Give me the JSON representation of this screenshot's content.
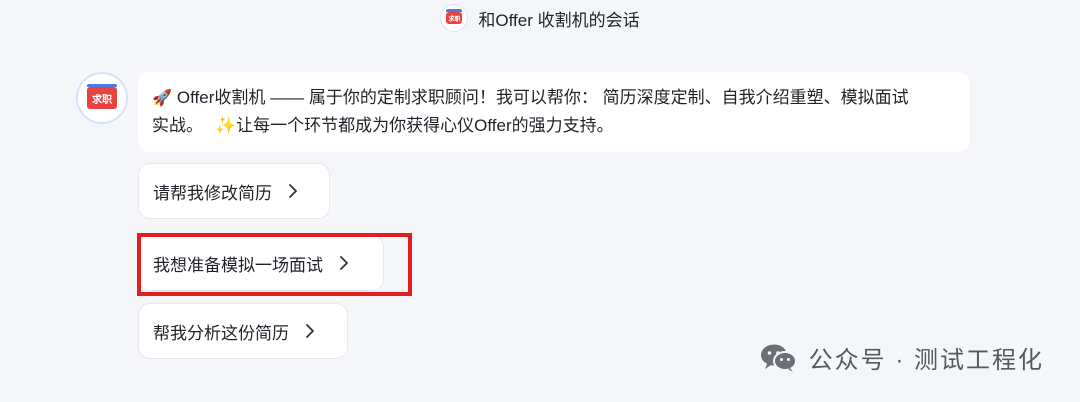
{
  "header": {
    "title": "和Offer 收割机的会话",
    "avatar_icon": "offer-harvester-logo-icon",
    "avatar_text": "求职"
  },
  "bot": {
    "avatar_icon": "offer-harvester-logo-icon",
    "avatar_text": "求职"
  },
  "message": {
    "rocket_icon": "rocket-emoji-icon",
    "line1": "Offer收割机 —— 属于你的定制求职顾问！我可以帮你： 简历深度定制、自我介绍重塑、模拟面试",
    "line2_before": "实战。",
    "sparkle_icon": "sparkle-emoji-icon",
    "line2_after": "让每一个环节都成为你获得心仪Offer的强力支持。"
  },
  "suggestions": [
    {
      "label": "请帮我修改简历"
    },
    {
      "label": "我想准备模拟一场面试"
    },
    {
      "label": "帮我分析这份简历"
    }
  ],
  "watermark": {
    "text": "公众号 · 测试工程化",
    "icon": "wechat-icon"
  },
  "colors": {
    "highlight": "#e0201f",
    "background": "#f5f6f9",
    "bubble": "#ffffff"
  }
}
